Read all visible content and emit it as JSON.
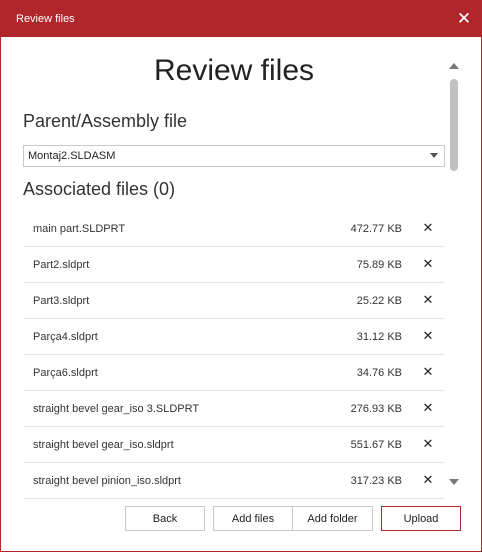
{
  "window": {
    "title": "Review files"
  },
  "heading": "Review files",
  "parent": {
    "label": "Parent/Assembly file",
    "selected": "Montaj2.SLDASM"
  },
  "associated": {
    "label": "Associated files (0)"
  },
  "files": [
    {
      "name": "main part.SLDPRT",
      "size": "472.77 KB"
    },
    {
      "name": "Part2.sldprt",
      "size": "75.89 KB"
    },
    {
      "name": "Part3.sldprt",
      "size": "25.22 KB"
    },
    {
      "name": "Parça4.sldprt",
      "size": "31.12 KB"
    },
    {
      "name": "Parça6.sldprt",
      "size": "34.76 KB"
    },
    {
      "name": "straight bevel gear_iso 3.SLDPRT",
      "size": "276.93 KB"
    },
    {
      "name": "straight bevel gear_iso.sldprt",
      "size": "551.67 KB"
    },
    {
      "name": "straight bevel pinion_iso.sldprt",
      "size": "317.23 KB"
    }
  ],
  "icons": {
    "close": "close-icon",
    "remove": "remove-icon",
    "dropdown": "chevron-down-icon"
  },
  "buttons": {
    "back": "Back",
    "add_files": "Add files",
    "add_folder": "Add folder",
    "upload": "Upload"
  },
  "colors": {
    "accent": "#b0262b"
  }
}
